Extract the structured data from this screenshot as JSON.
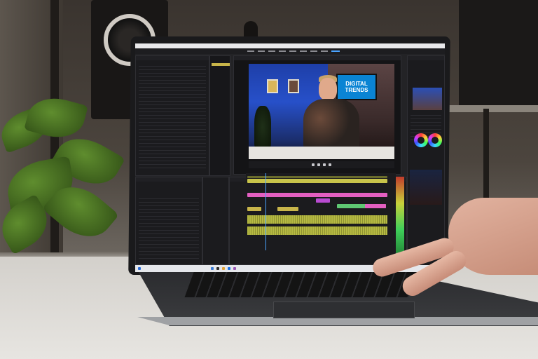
{
  "screen_overlay": {
    "tv_line1": "DIGITAL",
    "tv_line2": "TRENDS"
  },
  "colors": {
    "premiere_accent": "#4aa3ff",
    "studio_blue": "#2750c9",
    "tv_screen": "#0a84d4",
    "pink_clip": "#e35fc1",
    "green_clip": "#5fc873",
    "audio_clip": "#b6ba42"
  },
  "icons": [
    "speaker",
    "plant",
    "laptop",
    "hand",
    "color-wheel"
  ]
}
